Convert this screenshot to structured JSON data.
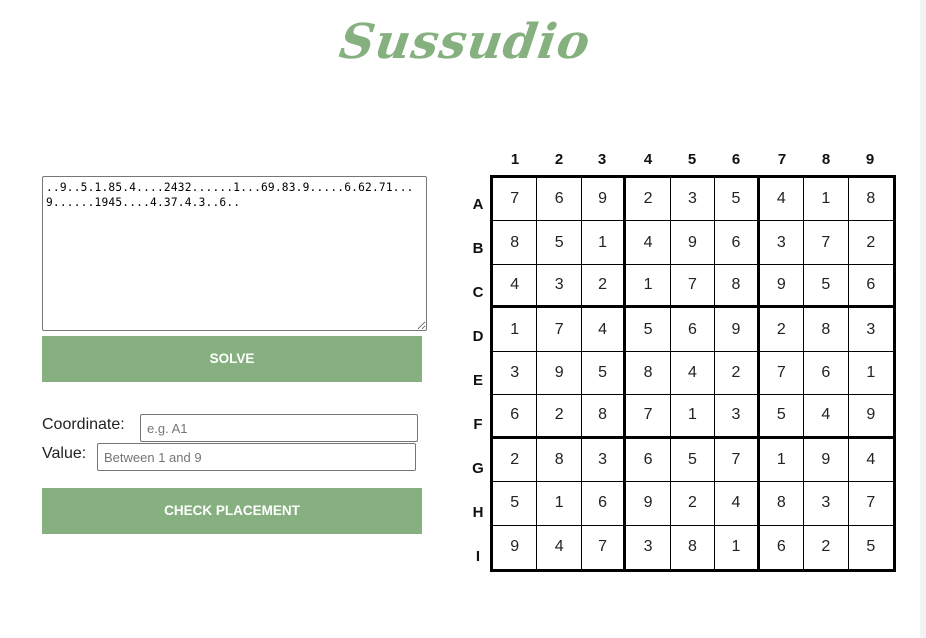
{
  "logo": {
    "text": "Sussudio"
  },
  "colors": {
    "accent": "#86b07f",
    "button_text": "#ffffff",
    "grid_border": "#000000"
  },
  "form": {
    "puzzle_string": "..9..5.1.85.4....2432......1...69.83.9.....6.62.71...9......1945....4.37.4.3..6..",
    "solve_label": "SOLVE",
    "coordinate_label": "Coordinate:",
    "coordinate_placeholder": "e.g. A1",
    "value_label": "Value:",
    "value_placeholder": "Between 1 and 9",
    "check_label": "CHECK PLACEMENT"
  },
  "grid": {
    "column_headers": [
      "1",
      "2",
      "3",
      "4",
      "5",
      "6",
      "7",
      "8",
      "9"
    ],
    "row_headers": [
      "A",
      "B",
      "C",
      "D",
      "E",
      "F",
      "G",
      "H",
      "I"
    ],
    "rows": [
      [
        "7",
        "6",
        "9",
        "2",
        "3",
        "5",
        "4",
        "1",
        "8"
      ],
      [
        "8",
        "5",
        "1",
        "4",
        "9",
        "6",
        "3",
        "7",
        "2"
      ],
      [
        "4",
        "3",
        "2",
        "1",
        "7",
        "8",
        "9",
        "5",
        "6"
      ],
      [
        "1",
        "7",
        "4",
        "5",
        "6",
        "9",
        "2",
        "8",
        "3"
      ],
      [
        "3",
        "9",
        "5",
        "8",
        "4",
        "2",
        "7",
        "6",
        "1"
      ],
      [
        "6",
        "2",
        "8",
        "7",
        "1",
        "3",
        "5",
        "4",
        "9"
      ],
      [
        "2",
        "8",
        "3",
        "6",
        "5",
        "7",
        "1",
        "9",
        "4"
      ],
      [
        "5",
        "1",
        "6",
        "9",
        "2",
        "4",
        "8",
        "3",
        "7"
      ],
      [
        "9",
        "4",
        "7",
        "3",
        "8",
        "1",
        "6",
        "2",
        "5"
      ]
    ]
  }
}
